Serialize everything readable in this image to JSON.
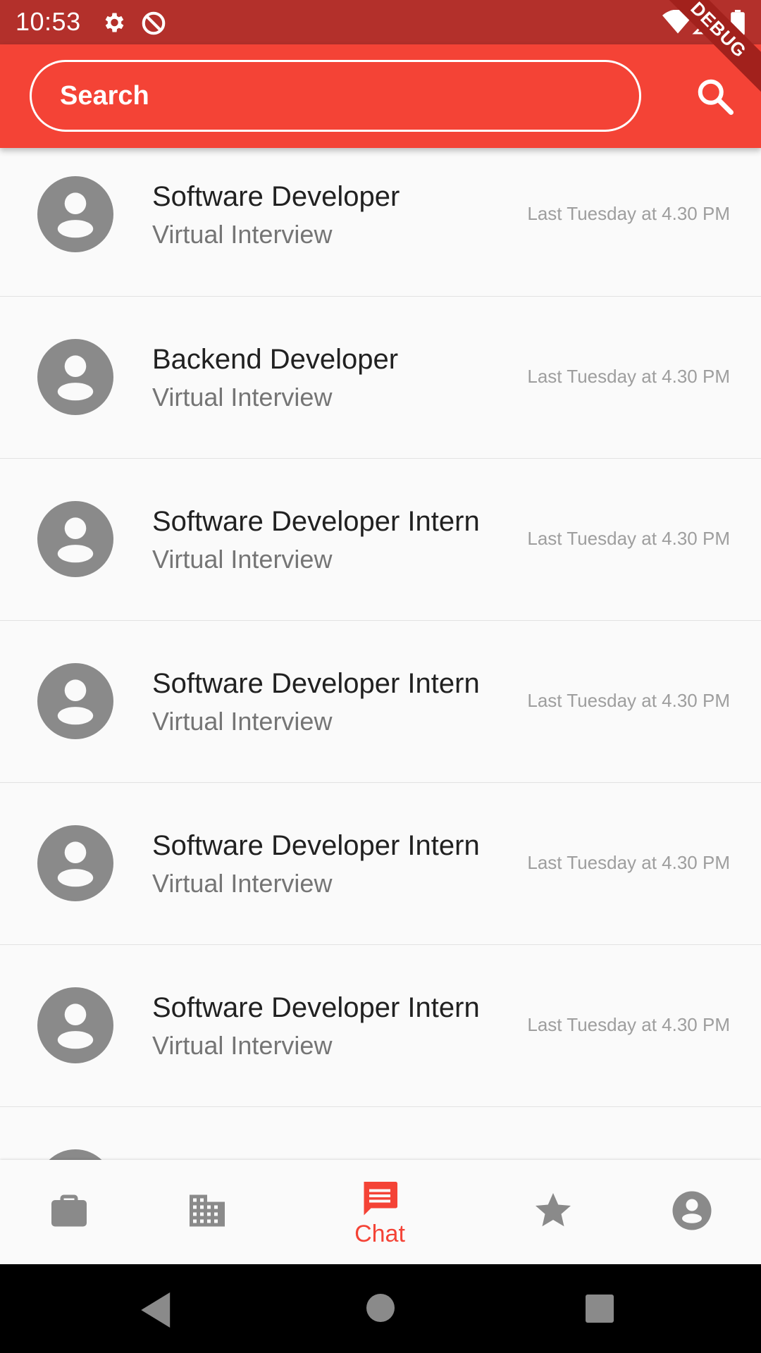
{
  "status_bar": {
    "time": "10:53",
    "icons": [
      "settings-icon",
      "do-not-disturb-icon",
      "wifi-icon",
      "signal-icon",
      "battery-icon"
    ]
  },
  "debug_banner": "DEBUG",
  "app_bar": {
    "search_placeholder": "Search",
    "search_icon": "search-icon"
  },
  "list": {
    "items": [
      {
        "title": "Software Developer",
        "subtitle": "Virtual Interview",
        "time": "Last Tuesday at 4.30 PM"
      },
      {
        "title": "Backend Developer",
        "subtitle": "Virtual Interview",
        "time": "Last Tuesday at 4.30 PM"
      },
      {
        "title": "Software Developer Intern",
        "subtitle": "Virtual Interview",
        "time": "Last Tuesday at 4.30 PM"
      },
      {
        "title": "Software Developer Intern",
        "subtitle": "Virtual Interview",
        "time": "Last Tuesday at 4.30 PM"
      },
      {
        "title": "Software Developer Intern",
        "subtitle": "Virtual Interview",
        "time": "Last Tuesday at 4.30 PM"
      },
      {
        "title": "Software Developer Intern",
        "subtitle": "Virtual Interview",
        "time": "Last Tuesday at 4.30 PM"
      }
    ]
  },
  "bottom_nav": {
    "items": [
      {
        "icon": "briefcase-icon",
        "label": ""
      },
      {
        "icon": "building-icon",
        "label": ""
      },
      {
        "icon": "chat-icon",
        "label": "Chat",
        "active": true
      },
      {
        "icon": "star-icon",
        "label": ""
      },
      {
        "icon": "account-icon",
        "label": ""
      }
    ]
  },
  "colors": {
    "primary": "#f44336",
    "status_bar": "#b3302b",
    "icon_grey": "#8a8a8a"
  }
}
